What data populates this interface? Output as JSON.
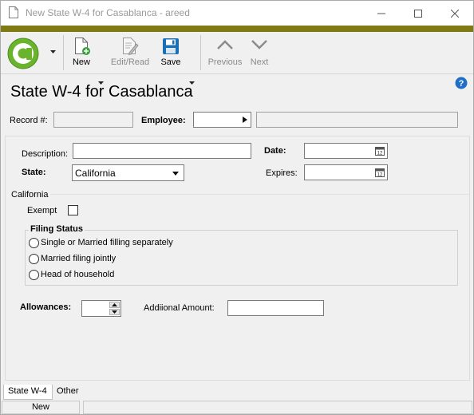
{
  "window": {
    "title": "New State W-4 for Casablanca - areed",
    "controls": [
      "minimize",
      "maximize",
      "close"
    ]
  },
  "toolbar": {
    "new_label": "New",
    "edit_read_label": "Edit/Read",
    "save_label": "Save",
    "previous_label": "Previous",
    "next_label": "Next",
    "logo_letter": "a"
  },
  "page": {
    "title": "State W-4 for Casablanca"
  },
  "header_fields": {
    "record_label": "Record #:",
    "record_value": "",
    "employee_label": "Employee:",
    "employee_value": "",
    "employee_name_value": ""
  },
  "form": {
    "description_label": "Description:",
    "description_value": "",
    "date_label": "Date:",
    "date_value": "",
    "state_label": "State:",
    "state_value": "California",
    "expires_label": "Expires:",
    "expires_value": ""
  },
  "california": {
    "section_title": "California",
    "exempt_label": "Exempt",
    "exempt_checked": false,
    "filing_status_title": "Filing Status",
    "filing_options": [
      "Single or Married filling separately",
      "Married filing jointly",
      "Head of household"
    ],
    "allowances_label": "Allowances:",
    "allowances_value": "",
    "additional_amount_label": "Addiional Amount:",
    "additional_amount_value": ""
  },
  "tabs": [
    "State W-4",
    "Other"
  ],
  "status_bar": {
    "mode": "New"
  },
  "colors": {
    "brand_bar": "#7f7a13",
    "logo_green": "#6ab42d",
    "save_blue": "#1b6fb5",
    "help_blue": "#1f6fc7"
  }
}
